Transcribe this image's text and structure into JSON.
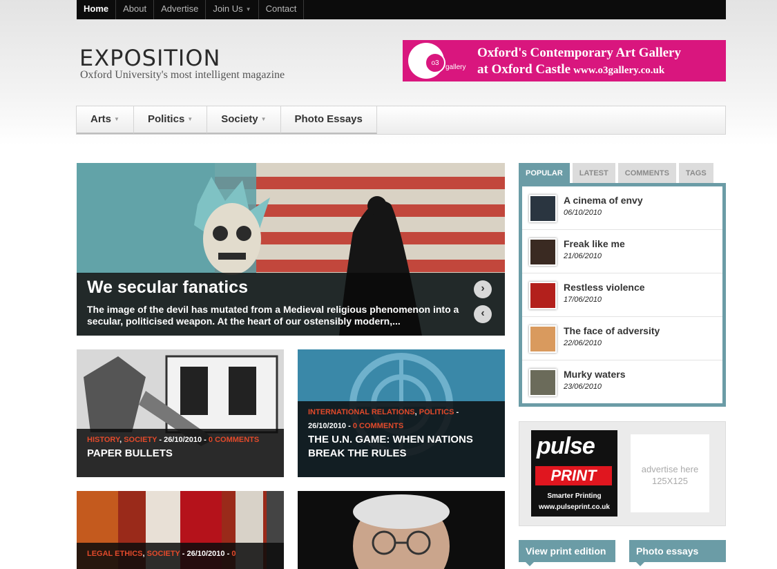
{
  "top_nav": [
    {
      "label": "Home",
      "active": true
    },
    {
      "label": "About"
    },
    {
      "label": "Advertise"
    },
    {
      "label": "Join Us",
      "has_dropdown": true
    },
    {
      "label": "Contact"
    }
  ],
  "site": {
    "title": "EXPOSITION",
    "tagline": "Oxford University's most intelligent magazine"
  },
  "banner_ad": {
    "logo_num": "o3",
    "logo_word": "gallery",
    "line1": "Oxford's Contemporary Art Gallery",
    "line2": "at Oxford Castle",
    "url": "www.o3gallery.co.uk",
    "color": "#d9167e"
  },
  "category_nav": [
    {
      "label": "Arts",
      "has_dropdown": true
    },
    {
      "label": "Politics",
      "has_dropdown": true
    },
    {
      "label": "Society",
      "has_dropdown": true
    },
    {
      "label": "Photo Essays",
      "has_dropdown": false
    }
  ],
  "featured": {
    "title": "We secular fanatics",
    "excerpt": "The image of the devil has mutated from a Medieval religious phenomenon into a secular, politicised weapon. At the heart of our ostensibly modern,...",
    "next_icon": "chevron-right-icon",
    "prev_icon": "chevron-left-icon"
  },
  "articles": [
    {
      "cat1": "HISTORY",
      "cat2": "SOCIETY",
      "date": " - 26/10/2010 - ",
      "comments": "0 COMMENTS",
      "title": "PAPER BULLETS"
    },
    {
      "cat1": "INTERNATIONAL RELATIONS",
      "cat2": "POLITICS",
      "date": " - 26/10/2010 - ",
      "comments": "0 COMMENTS",
      "title": "THE U.N. GAME: WHEN NATIONS BREAK THE RULES"
    },
    {
      "cat1": "LEGAL ETHICS",
      "cat2": "SOCIETY",
      "date": " - 26/10/2010 - ",
      "comments": "0",
      "title": ""
    },
    {
      "cat1": "",
      "cat2": "",
      "date": "",
      "comments": "",
      "title": ""
    }
  ],
  "sidebar": {
    "tabs": [
      {
        "label": "POPULAR",
        "active": true
      },
      {
        "label": "LATEST"
      },
      {
        "label": "COMMENTS"
      },
      {
        "label": "TAGS"
      }
    ],
    "popular": [
      {
        "title": "A cinema of envy",
        "date": "06/10/2010"
      },
      {
        "title": "Freak like me",
        "date": "21/06/2010"
      },
      {
        "title": "Restless violence",
        "date": "17/06/2010"
      },
      {
        "title": "The face of adversity",
        "date": "22/06/2010"
      },
      {
        "title": "Murky waters",
        "date": "23/06/2010"
      }
    ],
    "ad": {
      "brand_top": "pulse",
      "brand_bottom": "PRINT",
      "slogan": "Smarter Printing",
      "url": "www.pulseprint.co.uk",
      "slot_line1": "advertise here",
      "slot_line2": "125X125"
    },
    "buttons": {
      "print": "View print edition",
      "photo": "Photo essays"
    }
  },
  "colors": {
    "accent": "#6b9ca6",
    "category_red": "#e24a2b",
    "topbar": "#0c0c0c"
  }
}
